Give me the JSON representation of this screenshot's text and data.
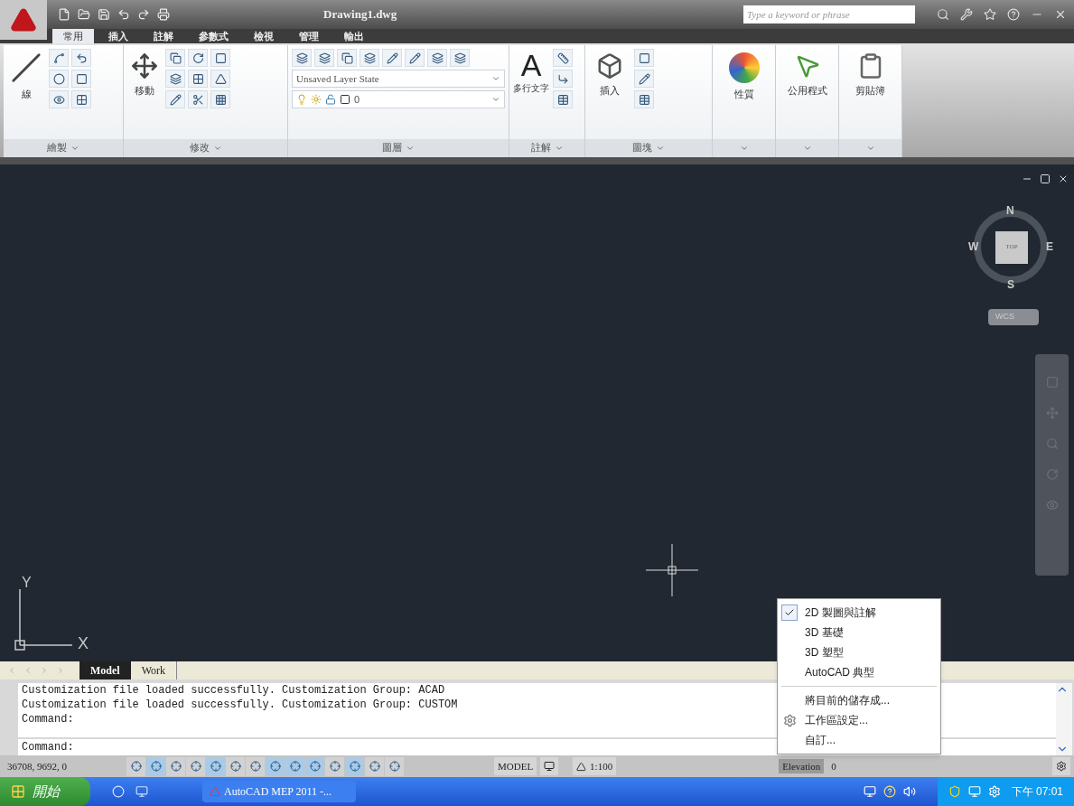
{
  "window": {
    "title": "Drawing1.dwg"
  },
  "search": {
    "placeholder": "Type a keyword or phrase"
  },
  "ribbon_tabs": [
    {
      "label": "常用",
      "selected": true
    },
    {
      "label": "插入",
      "selected": false
    },
    {
      "label": "註解",
      "selected": false
    },
    {
      "label": "參數式",
      "selected": false
    },
    {
      "label": "檢視",
      "selected": false
    },
    {
      "label": "管理",
      "selected": false
    },
    {
      "label": "輸出",
      "selected": false
    }
  ],
  "panels": [
    {
      "kind": "draw",
      "title": "繪製",
      "large_label": "線"
    },
    {
      "kind": "modify",
      "title": "修改",
      "large_label": "移動"
    },
    {
      "kind": "layers",
      "title": "圖層",
      "layer_state": "Unsaved Layer State",
      "layer": "0"
    },
    {
      "kind": "annotate",
      "title": "註解",
      "icon_glyph": "A",
      "large_label": "多行文字"
    },
    {
      "kind": "block",
      "title": "圖塊",
      "large_label": "插入"
    },
    {
      "kind": "properties",
      "large_label": "性質"
    },
    {
      "kind": "utilities",
      "large_label": "公用程式"
    },
    {
      "kind": "clipboard",
      "large_label": "剪貼簿"
    }
  ],
  "viewcube": {
    "north": "N",
    "west": "W",
    "east": "E",
    "south": "S",
    "face": "TOP",
    "ucs": "WCS"
  },
  "ucs_icon": {
    "y": "Y",
    "x": "X"
  },
  "layout_tabs": [
    {
      "label": "Model",
      "selected": true
    },
    {
      "label": "Work",
      "selected": false
    }
  ],
  "command_history": [
    "Customization file loaded successfully. Customization Group: ACAD",
    "Customization file loaded successfully. Customization Group: CUSTOM",
    "Command:"
  ],
  "command_prompt": "Command:",
  "status_bar": {
    "coordinates": "36708, 9692, 0",
    "model": "MODEL",
    "scale": "1:100",
    "elevation_label": "Elevation",
    "elevation": "0",
    "toggles": [
      {
        "on": false
      },
      {
        "on": true
      },
      {
        "on": false
      },
      {
        "on": false
      },
      {
        "on": true
      },
      {
        "on": false
      },
      {
        "on": false
      },
      {
        "on": true
      },
      {
        "on": true
      },
      {
        "on": true
      },
      {
        "on": false
      },
      {
        "on": true
      },
      {
        "on": false
      },
      {
        "on": false
      }
    ]
  },
  "workspace_menu": {
    "items": [
      {
        "kind": "workspace",
        "label": "2D 製圖與註解",
        "checked": true
      },
      {
        "kind": "workspace",
        "label": "3D 基礎",
        "checked": false
      },
      {
        "kind": "workspace",
        "label": "3D 塑型",
        "checked": false
      },
      {
        "kind": "workspace",
        "label": "AutoCAD 典型",
        "checked": false
      },
      {
        "kind": "action",
        "label": "將目前的儲存成..."
      },
      {
        "kind": "settings",
        "label": "工作區設定..."
      },
      {
        "kind": "action",
        "label": "自訂..."
      }
    ]
  },
  "taskbar": {
    "start": "開始",
    "tasks": [
      {
        "label": "AutoCAD MEP 2011 -..."
      }
    ],
    "clock": "下午 07:01"
  }
}
